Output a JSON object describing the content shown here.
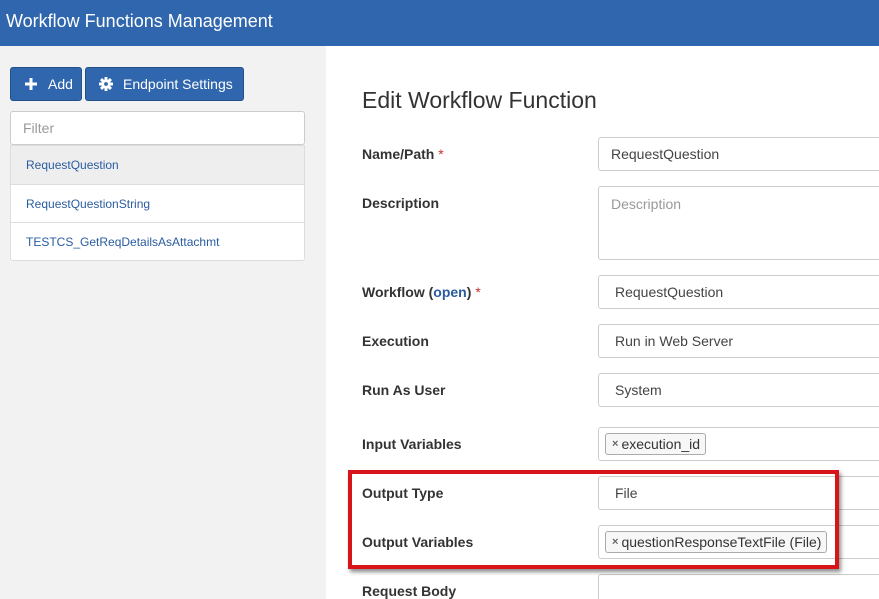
{
  "header": {
    "title": "Workflow Functions Management"
  },
  "toolbar": {
    "add_label": "Add",
    "endpoint_label": "Endpoint Settings"
  },
  "filter": {
    "placeholder": "Filter",
    "value": ""
  },
  "functions_list": [
    {
      "label": "RequestQuestion",
      "active": true
    },
    {
      "label": "RequestQuestionString",
      "active": false
    },
    {
      "label": "TESTCS_GetReqDetailsAsAttachmt",
      "active": false
    }
  ],
  "form": {
    "title": "Edit Workflow Function",
    "name": {
      "label": "Name/Path",
      "required": "*",
      "value": "RequestQuestion"
    },
    "description": {
      "label": "Description",
      "placeholder": "Description"
    },
    "workflow": {
      "label": "Workflow (",
      "link": "open",
      "label_end": ")",
      "required": "*",
      "value": "RequestQuestion"
    },
    "execution": {
      "label": "Execution",
      "value": "Run in Web Server"
    },
    "run_as_user": {
      "label": "Run As User",
      "value": "System"
    },
    "input_variables": {
      "label": "Input Variables",
      "tags": [
        "execution_id"
      ]
    },
    "output_type": {
      "label": "Output Type",
      "value": "File"
    },
    "output_variables": {
      "label": "Output Variables",
      "tags": [
        "questionResponseTextFile (File)"
      ]
    },
    "request_body": {
      "label": "Request Body"
    }
  },
  "icons": {
    "add": "plus-icon",
    "endpoint": "gear-icon",
    "tag_remove": "close-icon"
  },
  "colors": {
    "primary": "#2f66ad",
    "highlight": "#d7141a",
    "link": "#2a5ca0"
  }
}
